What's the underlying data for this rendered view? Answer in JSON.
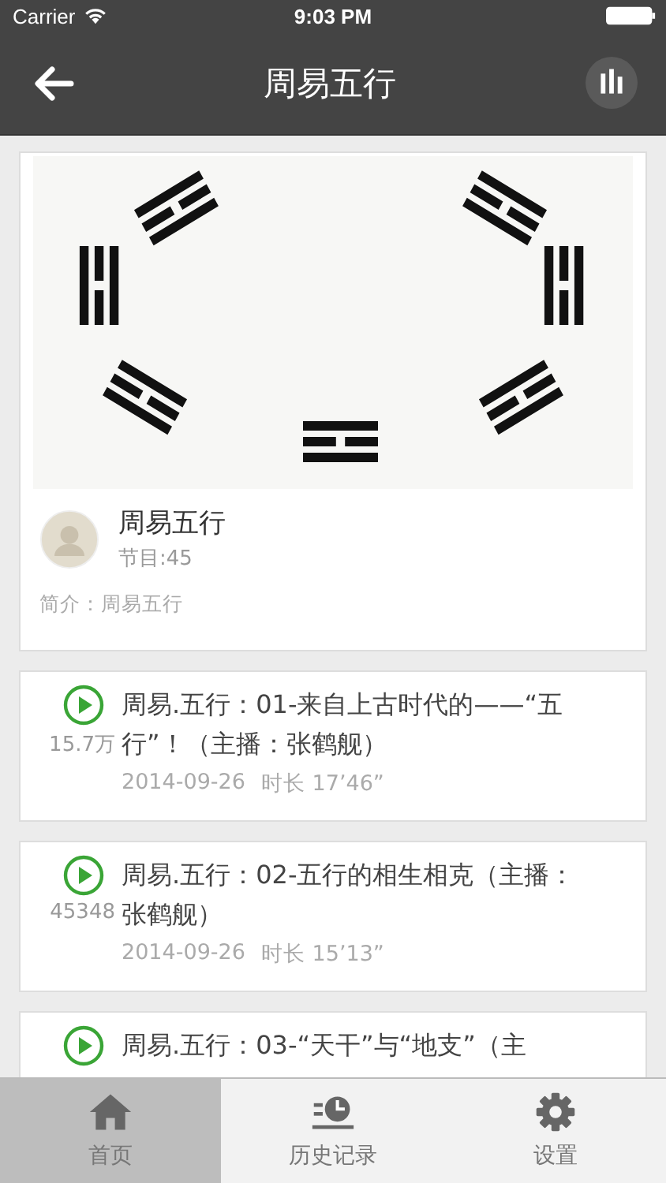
{
  "status_bar": {
    "carrier": "Carrier",
    "time": "9:03 PM"
  },
  "nav": {
    "title": "周易五行"
  },
  "album": {
    "title": "周易五行",
    "count": "节目:45",
    "intro": "简介：周易五行"
  },
  "episodes": [
    {
      "title": "周易.五行：01-来自上古时代的——“五行”！（主播：张鹤舰）",
      "plays": "15.7万",
      "date": "2014-09-26",
      "duration": "时长 17’46”"
    },
    {
      "title": "周易.五行：02-五行的相生相克（主播：张鹤舰）",
      "plays": "45348",
      "date": "2014-09-26",
      "duration": "时长 15’13”"
    },
    {
      "title": "周易.五行：03-“天干”与“地支”（主"
    }
  ],
  "tabs": [
    {
      "label": "首页",
      "kind": "home",
      "selected": true
    },
    {
      "label": "历史记录",
      "kind": "history",
      "selected": false
    },
    {
      "label": "设置",
      "kind": "settings",
      "selected": false
    }
  ]
}
